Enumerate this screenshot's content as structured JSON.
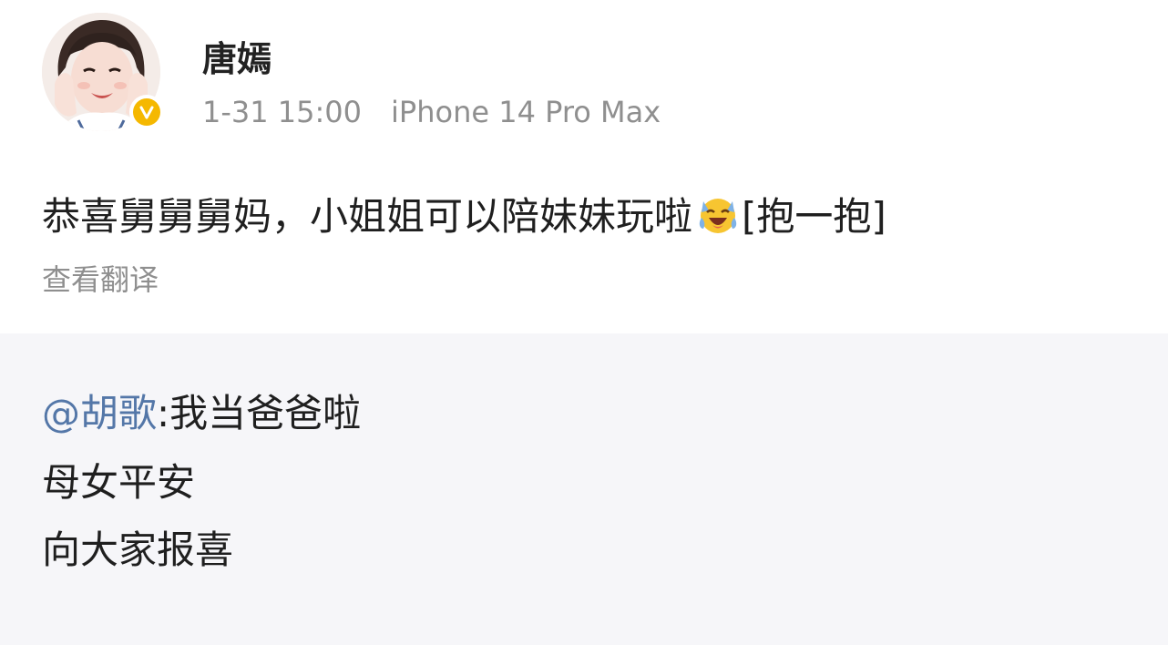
{
  "user": {
    "name": "唐嫣",
    "timestamp": "1-31 15:00",
    "source": "iPhone 14 Pro Max",
    "verified": true,
    "verified_color": "#f5b800"
  },
  "post": {
    "text_before_emoji": "恭喜舅舅舅妈，小姐姐可以陪妹妹玩啦",
    "emoji": "laughing-crying-emoji",
    "text_after_emoji": "[抱一抱]",
    "translate_label": "查看翻译"
  },
  "repost": {
    "mention": "@胡歌",
    "mention_color": "#5477a8",
    "first_line_text": ":我当爸爸啦",
    "line2": "母女平安",
    "line3": "向大家报喜"
  }
}
